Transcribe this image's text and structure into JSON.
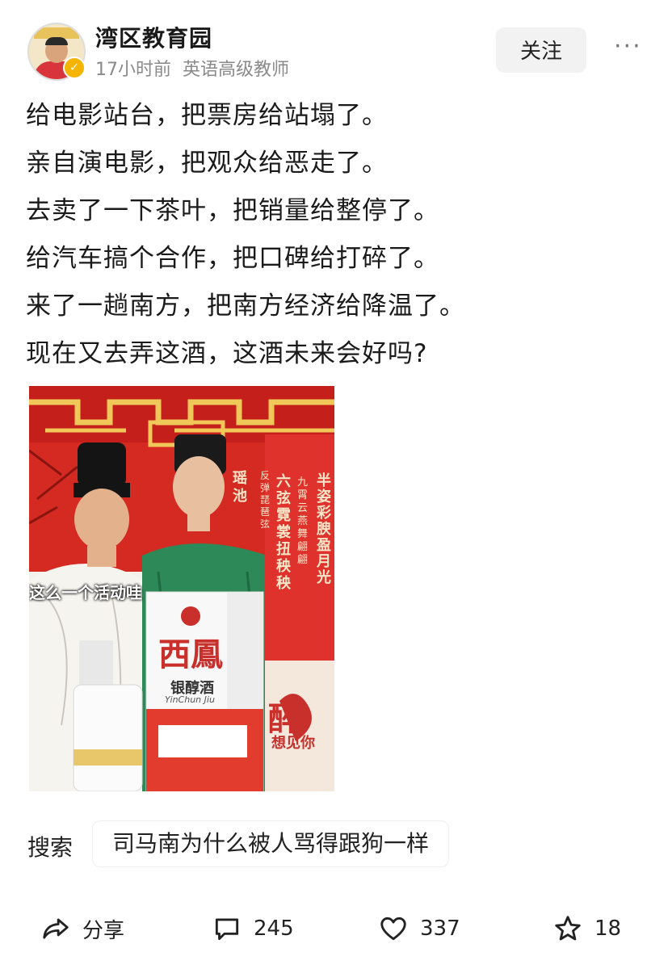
{
  "author": {
    "name": "湾区教育园",
    "time": "17小时前",
    "title": "英语高级教师",
    "avatar_icon": "avatar-portrait",
    "verified_icon": "verified-badge-icon",
    "follow_label": "关注",
    "more_icon": "more-icon"
  },
  "post": {
    "lines": [
      "给电影站台，把票房给站塌了。",
      "亲自演电影，把观众给恶走了。",
      "去卖了一下茶叶，把销量给整停了。",
      "给汽车搞个合作，把口碑给打碎了。",
      "来了一趟南方，把南方经济给降温了。",
      "现在又去弄这酒，这酒未来会好吗?"
    ]
  },
  "photo": {
    "caption": "这么一个活动哇",
    "brand": "西鳳",
    "product": "银醇酒",
    "product_pinyin": "YinChun Jiu",
    "banner_right_1": "半姿彩腴盈月光",
    "banner_right_2": "九霄云燕舞翩翩",
    "banner_right_3": "六弦霓裳扭秧秧",
    "banner_right_4": "反弹琵琶弦",
    "banner_left": "瑶池",
    "promo_big": "醉",
    "promo_small": "想见你"
  },
  "search": {
    "label": "搜索",
    "query": "司马南为什么被人骂得跟狗一样"
  },
  "actions": {
    "share_label": "分享",
    "comment_count": "245",
    "like_count": "337",
    "favorite_count": "18"
  },
  "colors": {
    "accent_red": "#d42a22",
    "gold": "#e8c25a",
    "verify": "#f5b400"
  }
}
